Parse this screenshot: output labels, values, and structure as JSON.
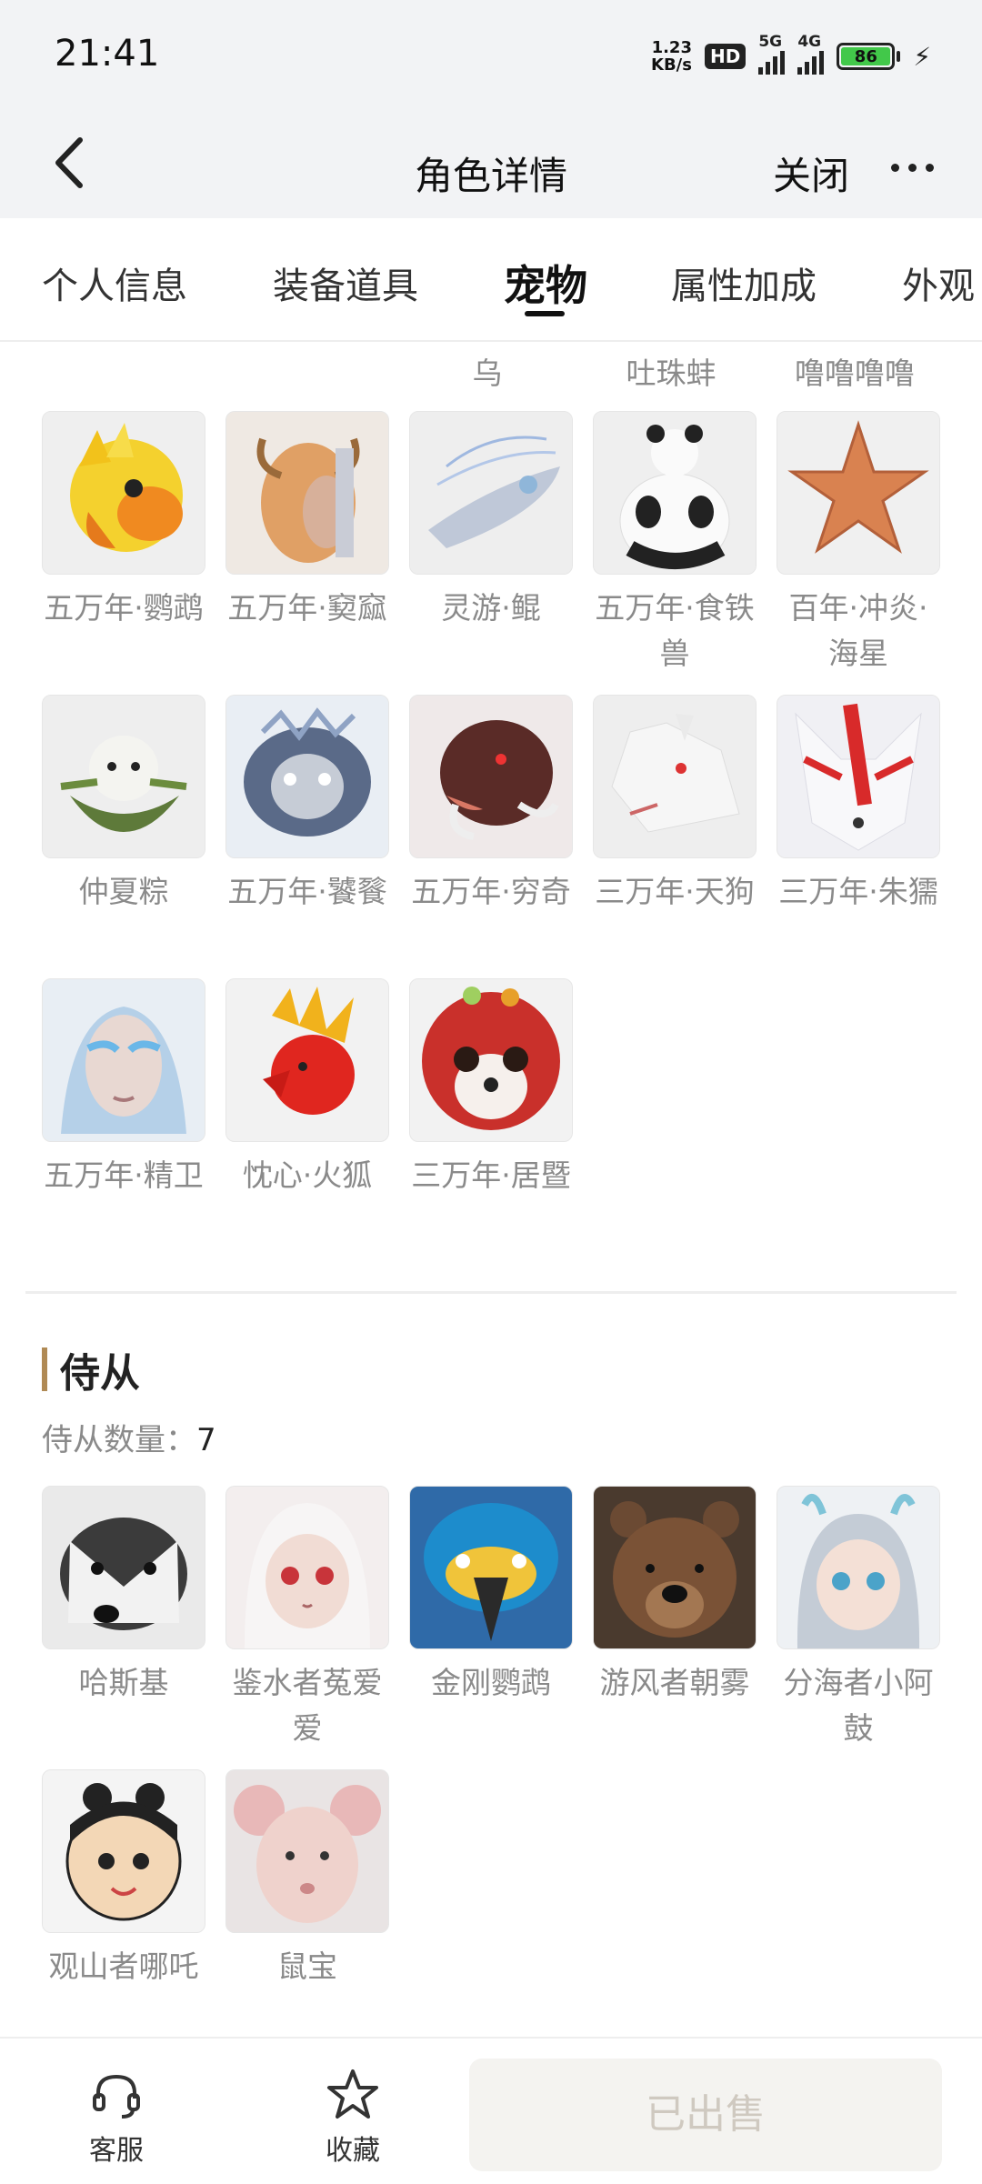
{
  "status": {
    "time": "21:41",
    "speed_value": "1.23",
    "speed_unit": "KB/s",
    "hd_badge": "HD",
    "net_5g": "5G",
    "net_4g": "4G",
    "battery": "86"
  },
  "nav": {
    "title": "角色详情",
    "close_label": "关闭"
  },
  "tabs": [
    "个人信息",
    "装备道具",
    "宠物",
    "属性加成",
    "外观"
  ],
  "pets_partial_labels": [
    "乌",
    "吐珠蚌",
    "噜噜噜噜"
  ],
  "pets": [
    "五万年·鹦鹉",
    "五万年·窫窳",
    "灵游·鲲",
    "五万年·食铁兽",
    "百年·冲炎·海星",
    "仲夏粽",
    "五万年·饕餮",
    "五万年·穷奇",
    "三万年·天狗",
    "三万年·朱獳",
    "五万年·精卫",
    "忱心·火狐",
    "三万年·居暨"
  ],
  "attendants_section": {
    "title": "侍从",
    "count_label": "侍从数量：",
    "count_value": "7",
    "items": [
      "哈斯基",
      "鉴水者菟爱爱",
      "金刚鹦鹉",
      "游风者朝雾",
      "分海者小阿鼓",
      "观山者哪吒",
      "鼠宝"
    ]
  },
  "bottom": {
    "service_label": "客服",
    "favorite_label": "收藏",
    "sold_label": "已出售"
  }
}
